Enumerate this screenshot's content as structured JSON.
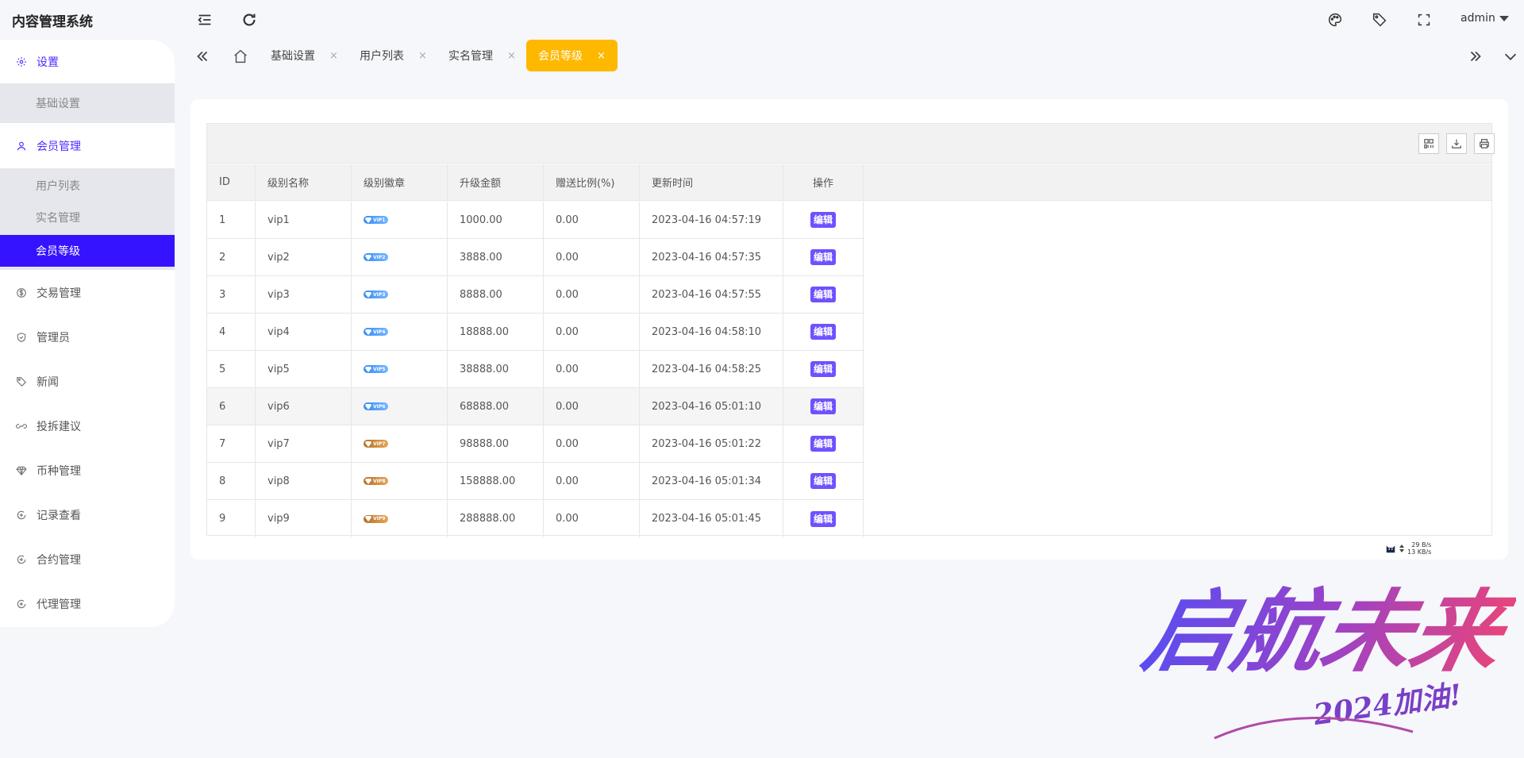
{
  "header": {
    "app_title": "内容管理系统",
    "user_name": "admin",
    "icons": [
      "menu-fold-icon",
      "refresh-icon",
      "theme-palette-icon",
      "tag-icon",
      "fullscreen-icon"
    ]
  },
  "sidebar": {
    "items": [
      {
        "label": "设置",
        "icon": "gear-icon"
      },
      {
        "label": "会员管理",
        "icon": "user-icon"
      },
      {
        "label": "交易管理",
        "icon": "dollar-icon"
      },
      {
        "label": "管理员",
        "icon": "shield-icon"
      },
      {
        "label": "新闻",
        "icon": "tag-icon"
      },
      {
        "label": "投拆建议",
        "icon": "link-icon"
      },
      {
        "label": "币种管理",
        "icon": "diamond-icon"
      },
      {
        "label": "记录查看",
        "icon": "circle-arrow-icon"
      },
      {
        "label": "合约管理",
        "icon": "circle-arrow-icon"
      },
      {
        "label": "代理管理",
        "icon": "circle-arrow-icon"
      }
    ],
    "settings_sub": [
      "基础设置"
    ],
    "member_sub": [
      "用户列表",
      "实名管理",
      "会员等级"
    ],
    "selected": "会员等级"
  },
  "tabs": {
    "items": [
      {
        "label": "基础设置"
      },
      {
        "label": "用户列表"
      },
      {
        "label": "实名管理"
      },
      {
        "label": "会员等级"
      }
    ],
    "active": "会员等级",
    "close_glyph": "×"
  },
  "table": {
    "columns": [
      "ID",
      "级别名称",
      "级别徽章",
      "升级金额",
      "赠送比例(%)",
      "更新时间",
      "操作"
    ],
    "edit_label": "编辑",
    "rows": [
      {
        "id": "1",
        "name": "vip1",
        "badge": "VIP1",
        "badge_color": "blue",
        "amount": "1000.00",
        "ratio": "0.00",
        "updated": "2023-04-16 04:57:19"
      },
      {
        "id": "2",
        "name": "vip2",
        "badge": "VIP2",
        "badge_color": "blue",
        "amount": "3888.00",
        "ratio": "0.00",
        "updated": "2023-04-16 04:57:35"
      },
      {
        "id": "3",
        "name": "vip3",
        "badge": "VIP3",
        "badge_color": "blue",
        "amount": "8888.00",
        "ratio": "0.00",
        "updated": "2023-04-16 04:57:55"
      },
      {
        "id": "4",
        "name": "vip4",
        "badge": "VIP4",
        "badge_color": "blue",
        "amount": "18888.00",
        "ratio": "0.00",
        "updated": "2023-04-16 04:58:10"
      },
      {
        "id": "5",
        "name": "vip5",
        "badge": "VIP5",
        "badge_color": "blue",
        "amount": "38888.00",
        "ratio": "0.00",
        "updated": "2023-04-16 04:58:25"
      },
      {
        "id": "6",
        "name": "vip6",
        "badge": "VIP6",
        "badge_color": "blue",
        "amount": "68888.00",
        "ratio": "0.00",
        "updated": "2023-04-16 05:01:10"
      },
      {
        "id": "7",
        "name": "vip7",
        "badge": "VIP7",
        "badge_color": "gold",
        "amount": "98888.00",
        "ratio": "0.00",
        "updated": "2023-04-16 05:01:22"
      },
      {
        "id": "8",
        "name": "vip8",
        "badge": "VIP8",
        "badge_color": "gold",
        "amount": "158888.00",
        "ratio": "0.00",
        "updated": "2023-04-16 05:01:34"
      },
      {
        "id": "9",
        "name": "vip9",
        "badge": "VIP9",
        "badge_color": "gold",
        "amount": "288888.00",
        "ratio": "0.00",
        "updated": "2023-04-16 05:01:45"
      }
    ],
    "toolbar_icons": [
      "columns-filter-icon",
      "export-icon",
      "print-icon"
    ]
  },
  "speed_widget": {
    "upload": "29 B/s",
    "download": "13 KB/s"
  },
  "watermark": {
    "main": "启航未来",
    "sub": "2024加油!"
  },
  "colors": {
    "accent": "#3513ff",
    "active_tab": "#ffb800",
    "edit_button": "#7051ff",
    "active_group_text": "#4c2dff"
  }
}
